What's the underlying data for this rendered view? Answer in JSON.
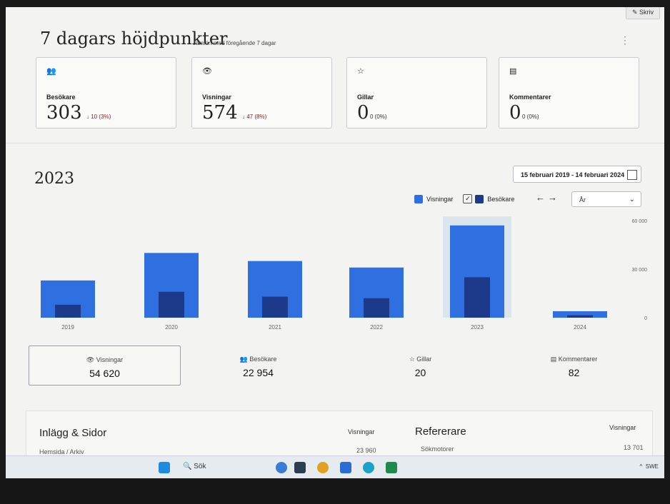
{
  "header": {
    "write_button": "Skriv",
    "title": "7 dagars höjdpunkter",
    "subtitle": "Jämfört med föregående 7 dagar"
  },
  "highlights": [
    {
      "icon": "people-icon",
      "label": "Besökare",
      "value": "303",
      "delta": "↓ 10 (3%)"
    },
    {
      "icon": "eye-icon",
      "label": "Visningar",
      "value": "574",
      "delta": "↓ 47 (8%)"
    },
    {
      "icon": "star-icon",
      "label": "Gillar",
      "value": "0",
      "delta": "0 (0%)"
    },
    {
      "icon": "comment-icon",
      "label": "Kommentarer",
      "value": "0",
      "delta": "0 (0%)"
    }
  ],
  "section": {
    "year": "2023",
    "date_range": "15 februari 2019 - 14 februari 2024",
    "legend_views": "Visningar",
    "legend_visitors": "Besökare",
    "legend_visitors_checked": true,
    "period_select": "År"
  },
  "colors": {
    "views": "#2f6fe0",
    "visitors": "#1d3a8a",
    "selected_bg": "#dbe5ee"
  },
  "chart_data": {
    "type": "bar",
    "categories": [
      "2019",
      "2020",
      "2021",
      "2022",
      "2023",
      "2024"
    ],
    "series": [
      {
        "name": "Visningar",
        "values": [
          23000,
          40000,
          35000,
          31000,
          57000,
          4000
        ]
      },
      {
        "name": "Besökare",
        "values": [
          8000,
          16000,
          13000,
          12000,
          25000,
          1500
        ]
      }
    ],
    "ylim": [
      0,
      60000
    ],
    "yticks": [
      "60 000",
      "30 000",
      "0"
    ],
    "selected_category": "2023",
    "grid": false,
    "legend": "top-right"
  },
  "stats": [
    {
      "icon": "eye-icon",
      "label": "Visningar",
      "value": "54 620",
      "selected": true
    },
    {
      "icon": "people-icon",
      "label": "Besökare",
      "value": "22 954",
      "selected": false
    },
    {
      "icon": "star-icon",
      "label": "Gillar",
      "value": "20",
      "selected": false
    },
    {
      "icon": "comment-icon",
      "label": "Kommentarer",
      "value": "82",
      "selected": false
    }
  ],
  "posts": {
    "title": "Inlägg & Sidor",
    "column": "Visningar",
    "row_label": "Hemsida / Arkiv",
    "row_value": "23 960"
  },
  "referrers": {
    "title": "Refererare",
    "column": "Visningar",
    "row_label": "Sökmotorer",
    "row_value": "13 701"
  },
  "taskbar": {
    "search": "Sök",
    "lang": "SWE"
  }
}
